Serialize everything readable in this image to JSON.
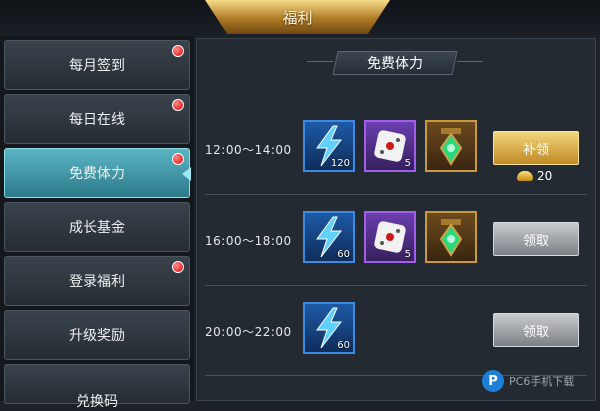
{
  "window": {
    "title": "福利"
  },
  "sidebar": {
    "items": [
      {
        "label": "每月签到",
        "badge": true,
        "active": false
      },
      {
        "label": "每日在线",
        "badge": true,
        "active": false
      },
      {
        "label": "免费体力",
        "badge": true,
        "active": true
      },
      {
        "label": "成长基金",
        "badge": false,
        "active": false
      },
      {
        "label": "登录福利",
        "badge": true,
        "active": false
      },
      {
        "label": "升级奖励",
        "badge": false,
        "active": false
      },
      {
        "label": "兑换码",
        "badge": false,
        "active": false
      }
    ]
  },
  "panel": {
    "header": "免费体力",
    "rows": [
      {
        "time": "12:00～14:00",
        "rewards": [
          {
            "icon": "energy-lightning-icon",
            "qty": "120",
            "frame": "blue"
          },
          {
            "icon": "dice-icon",
            "qty": "5",
            "frame": "purple"
          },
          {
            "icon": "green-gem-lantern-icon",
            "qty": "",
            "frame": "gold"
          }
        ],
        "button": "补领",
        "button_style": "gold",
        "cost": "20",
        "cost_icon": "gold-ingot-icon"
      },
      {
        "time": "16:00～18:00",
        "rewards": [
          {
            "icon": "energy-lightning-icon",
            "qty": "60",
            "frame": "blue"
          },
          {
            "icon": "dice-icon",
            "qty": "5",
            "frame": "purple"
          },
          {
            "icon": "green-gem-lantern-icon",
            "qty": "",
            "frame": "gold"
          }
        ],
        "button": "领取",
        "button_style": "gray"
      },
      {
        "time": "20:00～22:00",
        "rewards": [
          {
            "icon": "energy-lightning-icon",
            "qty": "60",
            "frame": "blue"
          }
        ],
        "button": "领取",
        "button_style": "gray"
      }
    ]
  },
  "watermark": {
    "logo": "P",
    "text": "PC6手机下载"
  },
  "colors": {
    "accent": "#5cb5c4",
    "gold": "#d9a63c",
    "badge": "#e01010"
  }
}
